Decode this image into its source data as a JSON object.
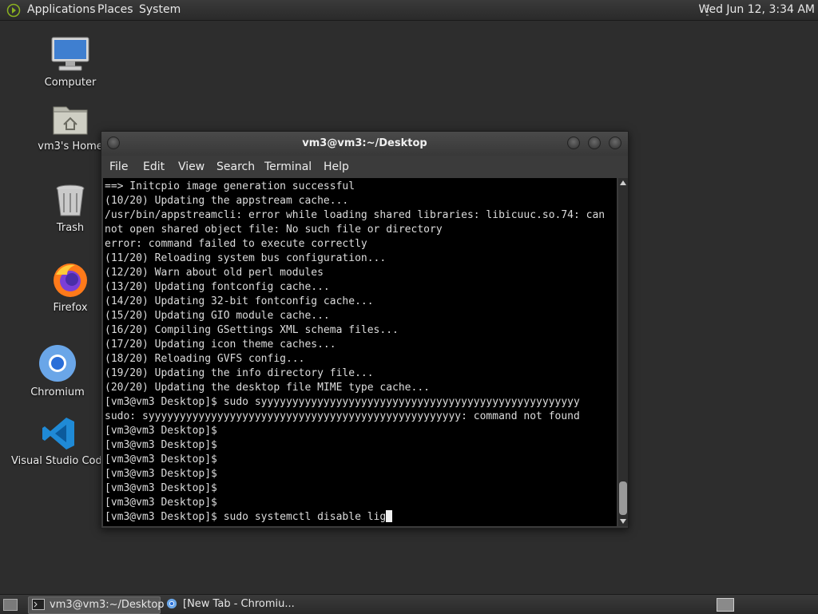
{
  "top_panel": {
    "menus": [
      "Applications",
      "Places",
      "System"
    ],
    "clock": "Wed Jun 12,  3:34 AM"
  },
  "desktop_icons": [
    {
      "label": "Computer",
      "icon": "computer-icon"
    },
    {
      "label": "vm3's Home",
      "icon": "home-folder-icon"
    },
    {
      "label": "Trash",
      "icon": "trash-icon"
    },
    {
      "label": "Firefox",
      "icon": "firefox-icon"
    },
    {
      "label": "Chromium",
      "icon": "chromium-icon"
    },
    {
      "label": "Visual Studio Code",
      "icon": "vscode-icon"
    }
  ],
  "terminal": {
    "title": "vm3@vm3:~/Desktop",
    "menu": [
      "File",
      "Edit",
      "View",
      "Search",
      "Terminal",
      "Help"
    ],
    "lines": [
      "==> Initcpio image generation successful",
      "(10/20) Updating the appstream cache...",
      "/usr/bin/appstreamcli: error while loading shared libraries: libicuuc.so.74: can",
      "not open shared object file: No such file or directory",
      "error: command failed to execute correctly",
      "(11/20) Reloading system bus configuration...",
      "(12/20) Warn about old perl modules",
      "(13/20) Updating fontconfig cache...",
      "(14/20) Updating 32-bit fontconfig cache...",
      "(15/20) Updating GIO module cache...",
      "(16/20) Compiling GSettings XML schema files...",
      "(17/20) Updating icon theme caches...",
      "(18/20) Reloading GVFS config...",
      "(19/20) Updating the info directory file...",
      "(20/20) Updating the desktop file MIME type cache...",
      "[vm3@vm3 Desktop]$ sudo syyyyyyyyyyyyyyyyyyyyyyyyyyyyyyyyyyyyyyyyyyyyyyyyyyy",
      "sudo: syyyyyyyyyyyyyyyyyyyyyyyyyyyyyyyyyyyyyyyyyyyyyyyyyy: command not found",
      "[vm3@vm3 Desktop]$",
      "[vm3@vm3 Desktop]$",
      "[vm3@vm3 Desktop]$",
      "[vm3@vm3 Desktop]$",
      "[vm3@vm3 Desktop]$",
      "[vm3@vm3 Desktop]$"
    ],
    "prompt_line": "[vm3@vm3 Desktop]$ sudo systemctl disable lig"
  },
  "taskbar": {
    "tasks": [
      {
        "label": "vm3@vm3:~/Desktop",
        "active": true
      },
      {
        "label": "[New Tab - Chromiu...",
        "active": false
      }
    ]
  }
}
